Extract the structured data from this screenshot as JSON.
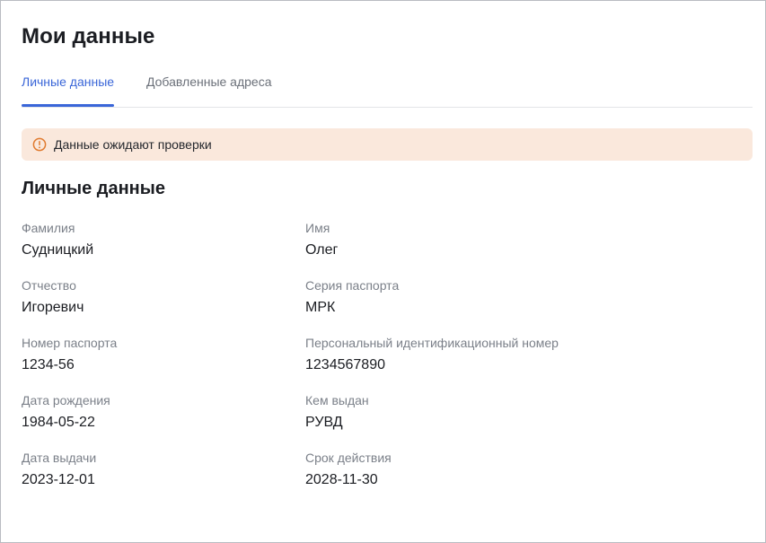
{
  "header": {
    "title": "Мои данные"
  },
  "tabs": [
    {
      "label": "Личные данные",
      "active": true
    },
    {
      "label": "Добавленные адреса",
      "active": false
    }
  ],
  "alert": {
    "icon": "warning-circle-icon",
    "text": "Данные ожидают проверки",
    "color": "#e07a2e",
    "background": "#fae8dc"
  },
  "section": {
    "title": "Личные данные"
  },
  "fields": [
    {
      "label": "Фамилия",
      "value": "Судницкий"
    },
    {
      "label": "Имя",
      "value": "Олег"
    },
    {
      "label": "Отчество",
      "value": "Игоревич"
    },
    {
      "label": "Серия паспорта",
      "value": "МРК"
    },
    {
      "label": "Номер паспорта",
      "value": "1234-56"
    },
    {
      "label": "Персональный идентификационный номер",
      "value": "1234567890"
    },
    {
      "label": "Дата рождения",
      "value": "1984-05-22"
    },
    {
      "label": "Кем выдан",
      "value": "РУВД"
    },
    {
      "label": "Дата выдачи",
      "value": "2023-12-01"
    },
    {
      "label": "Срок действия",
      "value": "2028-11-30"
    }
  ],
  "theme": {
    "accent": "#3a66d8",
    "text": "#1b1d22",
    "muted": "#7b8089"
  }
}
